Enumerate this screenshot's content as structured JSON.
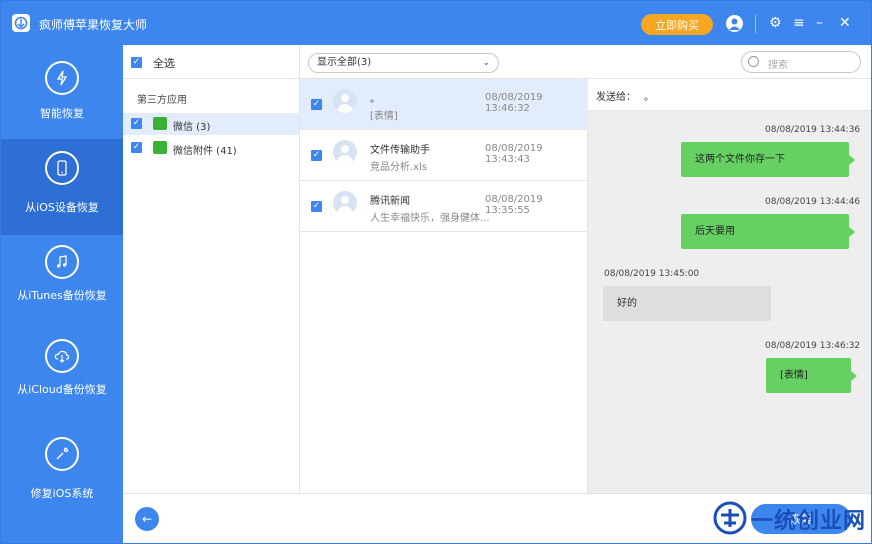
{
  "app": {
    "title": "疯师傅苹果恢复大师",
    "buy_label": "立即购买"
  },
  "sidebar": {
    "items": [
      {
        "label": "智能恢复"
      },
      {
        "label": "从iOS设备恢复"
      },
      {
        "label": "从iTunes备份恢复"
      },
      {
        "label": "从iCloud备份恢复"
      },
      {
        "label": "修复iOS系统"
      }
    ]
  },
  "panel1": {
    "select_all": "全选",
    "group_label": "第三方应用",
    "items": [
      {
        "label": "微信 (3)"
      },
      {
        "label": "微信附件 (41)"
      }
    ]
  },
  "panel2": {
    "filter": "显示全部(3)",
    "messages": [
      {
        "name": "。",
        "preview": "[表情]",
        "time": "08/08/2019 13:46:32"
      },
      {
        "name": "文件传输助手",
        "preview": "竞品分析.xls",
        "time": "08/08/2019 13:43:43"
      },
      {
        "name": "腾讯新闻",
        "preview": "人生幸福快乐，强身健体...",
        "time": "08/08/2019 13:35:55"
      }
    ]
  },
  "panel3": {
    "search_placeholder": "搜索",
    "to_label": "发送给：",
    "to_value": "。",
    "chat": [
      {
        "time": "08/08/2019 13:44:36",
        "text": "这两个文件你存一下"
      },
      {
        "time": "08/08/2019 13:44:46",
        "text": "后天要用"
      },
      {
        "time": "08/08/2019 13:45:00",
        "text": "好的"
      },
      {
        "time": "08/08/2019 13:46:32",
        "text": "[表情]"
      }
    ]
  },
  "footer": {
    "back_glyph": "←",
    "restore_label": "恢复"
  },
  "watermark": {
    "text": "一统创业网"
  },
  "colors": {
    "primary": "#3d86ee",
    "active_nav": "#2e6fd6",
    "buy": "#f5a623",
    "my_bubble": "#66d162",
    "other_bubble": "#dedede"
  }
}
